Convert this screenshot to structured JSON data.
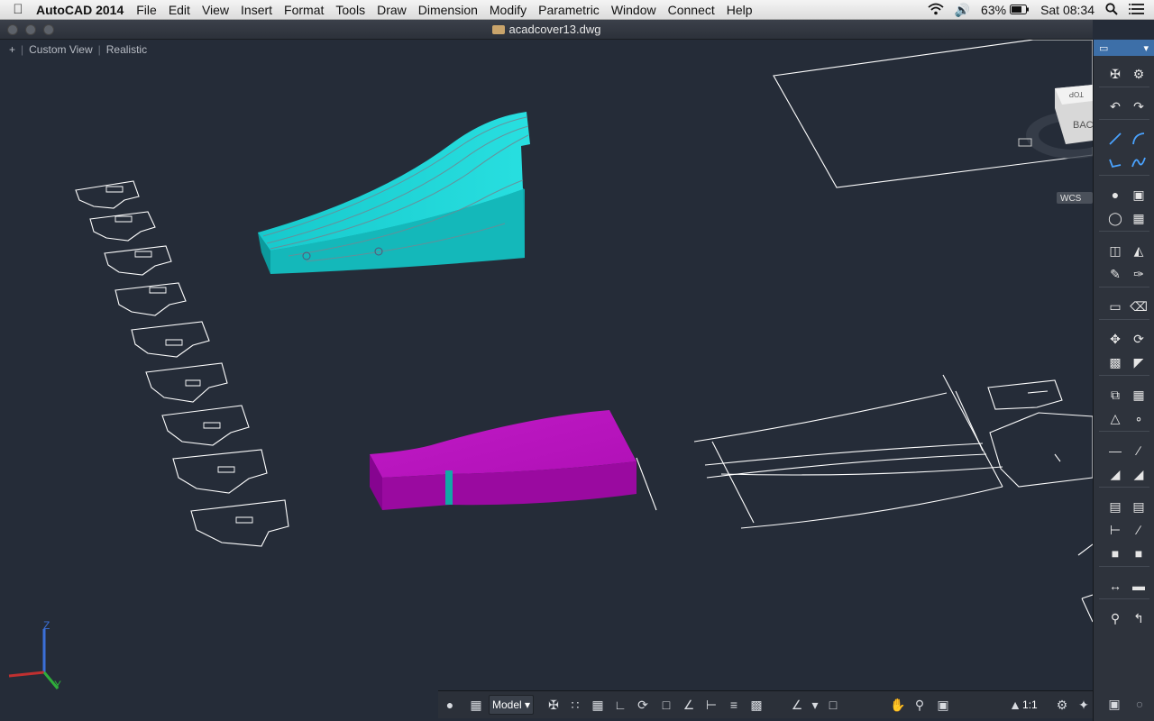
{
  "menubar": {
    "apple_icon": "apple-icon",
    "app_name": "AutoCAD 2014",
    "items": [
      "File",
      "Edit",
      "View",
      "Insert",
      "Format",
      "Tools",
      "Draw",
      "Dimension",
      "Modify",
      "Parametric",
      "Window",
      "Connect",
      "Help"
    ],
    "battery": "63%",
    "clock": "Sat 08:34"
  },
  "window": {
    "title": "acadcover13.dwg"
  },
  "viewport": {
    "plus": "+",
    "view": "Custom View",
    "style": "Realistic",
    "cube_top": "TOP",
    "cube_back": "BAC",
    "wcs": "WCS",
    "ucs_z": "Z",
    "ucs_y": "Y"
  },
  "statusbar": {
    "model_tab": "Model",
    "scale": "1:1"
  },
  "colors": {
    "background": "#252c38",
    "solid_cyan": "#12c6c8",
    "solid_magenta": "#b312b8",
    "wire": "#ffffff"
  }
}
